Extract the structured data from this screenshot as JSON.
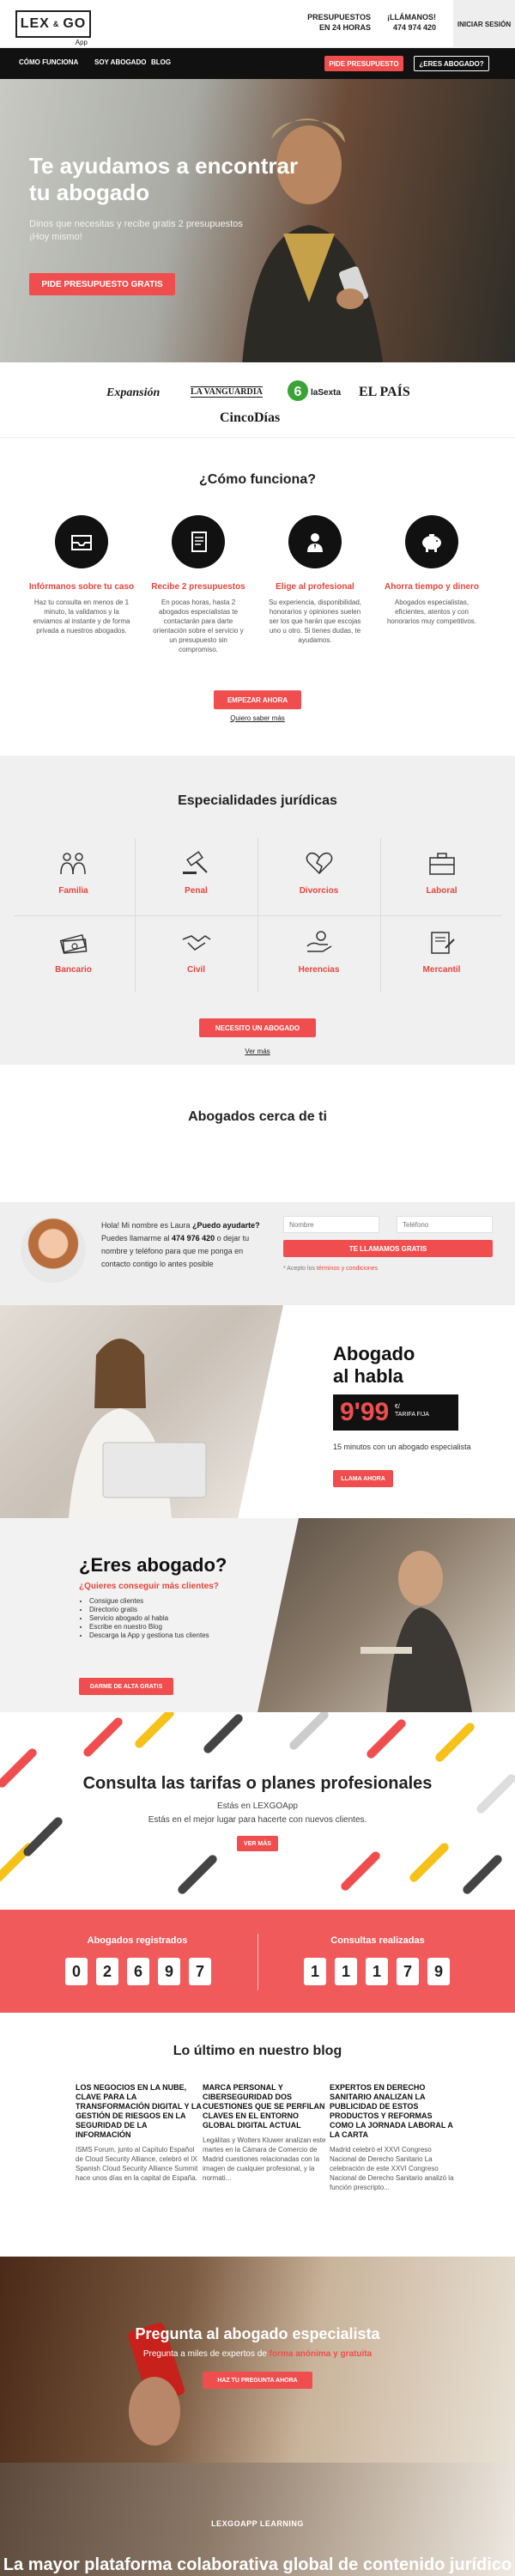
{
  "header": {
    "logo_left": "LEX",
    "logo_amp": "&",
    "logo_right": "GO",
    "logo_sub": "App",
    "budget_line1": "PRESUPUESTOS",
    "budget_line2": "EN 24 HORAS",
    "call_line1": "¡LLÁMANOS!",
    "call_line2": "474 974 420",
    "login": "INICIAR SESIÓN"
  },
  "nav": {
    "items": [
      "CÓMO FUNCIONA",
      "SOY ABOGADO",
      "BLOG"
    ],
    "budget_button": "PIDE PRESUPUESTO",
    "lawyer_button": "¿ERES ABOGADO?"
  },
  "hero": {
    "title": "Te ayudamos a encontrar tu abogado",
    "subtitle": "Dinos que necesitas y recibe gratis 2 presupuestos ¡Hoy mismo!",
    "cta": "PIDE PRESUPUESTO GRATIS"
  },
  "press": [
    "Expansión",
    "LA VANGUARDIA",
    "laSexta",
    "EL PAÍS",
    "CincoDías"
  ],
  "how": {
    "title": "¿Cómo funciona?",
    "steps": [
      {
        "label": "Infórmanos sobre tu caso",
        "text": "Haz tu consulta en menos de 1 minuto, la validamos y la enviamos al instante y de forma privada a nuestros abogados."
      },
      {
        "label": "Recibe 2 presupuestos",
        "text": "En pocas horas, hasta 2 abogados especialistas te contactarán para darte orientación sobre el servicio y un presupuesto sin compromiso."
      },
      {
        "label": "Elige al profesional",
        "text": "Su experiencia, disponibilidad, honorarios y opiniones suelen ser los que harán que escojas uno u otro. Si tienes dudas, te ayudamos."
      },
      {
        "label": "Ahorra tiempo y dinero",
        "text": "Abogados especialistas, eficientes, atentos y con honorarios muy competitivos."
      }
    ],
    "button": "EMPEZAR AHORA",
    "more": "Quiero saber más"
  },
  "specialties": {
    "title": "Especialidades jurídicas",
    "items": [
      {
        "name": "Familia",
        "icon": "family-icon"
      },
      {
        "name": "Penal",
        "icon": "gavel-icon"
      },
      {
        "name": "Divorcios",
        "icon": "broken-heart-icon"
      },
      {
        "name": "Laboral",
        "icon": "briefcase-icon"
      },
      {
        "name": "Bancario",
        "icon": "money-icon"
      },
      {
        "name": "Civil",
        "icon": "handshake-icon"
      },
      {
        "name": "Herencias",
        "icon": "inheritance-icon"
      },
      {
        "name": "Mercantil",
        "icon": "contract-icon"
      }
    ],
    "button": "NECESITO UN ABOGADO",
    "more": "Ver más"
  },
  "nearby": {
    "title": "Abogados cerca de ti"
  },
  "contact": {
    "msg_prefix": "Hola! Mi nombre es Laura ",
    "msg_bold1": "¿Puedo ayudarte?",
    "msg_mid": " Puedes llamarme al ",
    "msg_bold2": "474 976 420",
    "msg_suffix": " o dejar tu nombre y teléfono para que me ponga en contacto contigo lo antes posible",
    "name_placeholder": "Nombre",
    "phone_placeholder": "Teléfono",
    "button": "TE LLAMAMOS GRATIS",
    "accept_prefix": "* Acepto los ",
    "accept_link": "términos y condiciones"
  },
  "talk": {
    "title_line1": "Abogado",
    "title_line2": "al habla",
    "price": "9'99",
    "unit_line1": "€/",
    "unit_line2": "TARIFA FIJA",
    "note": "15 minutos con un abogado especialista",
    "button": "LLAMA AHORA"
  },
  "lawyers": {
    "title": "¿Eres abogado?",
    "subtitle": "¿Quieres conseguir más clientes?",
    "bullets": [
      "Consigue clientes",
      "Directorio gratis",
      "Servicio abogado al habla",
      "Escribe en nuestro Blog",
      "Descarga la App y gestiona tus clientes"
    ],
    "button": "DARME DE ALTA GRATIS"
  },
  "rates": {
    "title": "Consulta las tarifas o planes profesionales",
    "line1": "Estás en LEXGOApp",
    "line2": "Estás en el mejor lugar para hacerte con nuevos clientes.",
    "button": "VER MÁS"
  },
  "stats": {
    "registered_label": "Abogados registrados",
    "registered_digits": [
      "0",
      "2",
      "6",
      "9",
      "7"
    ],
    "consults_label": "Consultas realizadas",
    "consults_digits": [
      "1",
      "1",
      "1",
      "7",
      "9"
    ]
  },
  "blog": {
    "title": "Lo último en nuestro blog",
    "posts": [
      {
        "title": "LOS NEGOCIOS EN LA NUBE, CLAVE PARA LA TRANSFORMACIÓN DIGITAL Y LA GESTIÓN DE RIESGOS EN LA SEGURIDAD DE LA INFORMACIÓN",
        "text": "ISMS Forum, junto al Capítulo Español de Cloud Security Alliance, celebró el IX Spanish Cloud Security Alliance Summit hace unos días en la capital de España."
      },
      {
        "title": "MARCA PERSONAL Y CIBERSEGURIDAD DOS CUESTIONES QUE SE PERFILAN CLAVES EN EL ENTORNO GLOBAL DIGITAL ACTUAL",
        "text": "Legálitas y Wolters Kluwer analizan este martes en la Cámara de Comercio de Madrid cuestiones relacionadas con la imagen de cualquier profesional, y la normati..."
      },
      {
        "title": "EXPERTOS EN DERECHO SANITARIO ANALIZAN LA PUBLICIDAD DE ESTOS PRODUCTOS Y REFORMAS COMO LA JORNADA LABORAL A LA CARTA",
        "text": "Madrid celebró el XXVI Congreso Nacional de Derecho Sanitario La celebración de este XXVI Congreso Nacional de Derecho Sanitario analizó la función prescripto..."
      }
    ]
  },
  "ask": {
    "title": "Pregunta al abogado especialista",
    "text_prefix": "Pregunta a miles de expertos de ",
    "text_bold": "forma anónima y gratuita",
    "button": "HAZ TU PREGUNTA AHORA"
  },
  "learning": {
    "tag": "LEXGOAPP LEARNING",
    "title": "La mayor plataforma colaborativa global de contenido jurídico"
  },
  "colors": {
    "accent": "#f04e4e",
    "dark": "#111111"
  }
}
